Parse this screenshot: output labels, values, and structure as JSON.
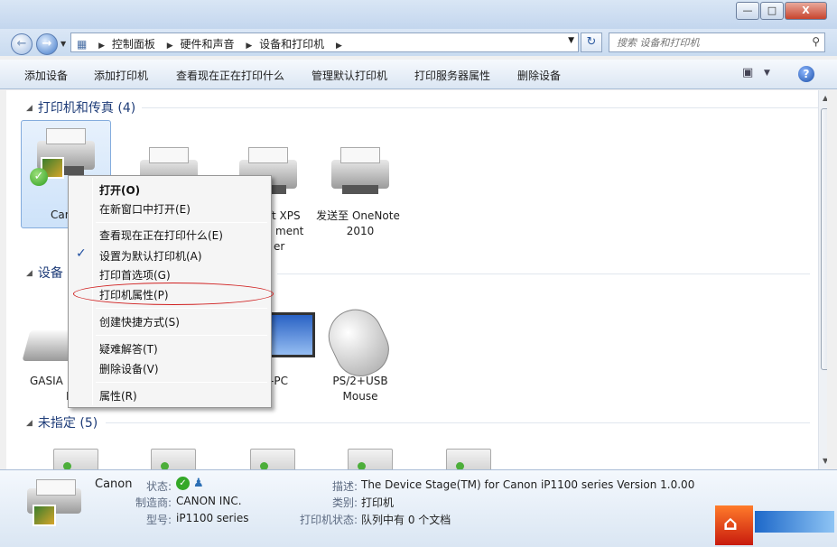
{
  "titlebar": {
    "minimize_icon": "minimize-icon",
    "maximize_icon": "maximize-icon",
    "close_icon": "close-icon"
  },
  "address": {
    "breadcrumbs": [
      "控制面板",
      "硬件和声音",
      "设备和打印机"
    ],
    "search_placeholder": "搜索 设备和打印机"
  },
  "toolbar": {
    "items": [
      "添加设备",
      "添加打印机",
      "查看现在正在打印什么",
      "管理默认打印机",
      "打印服务器属性",
      "删除设备"
    ]
  },
  "groups": {
    "printers": {
      "title": "打印机和传真 (4)"
    },
    "devices": {
      "title": "设备 (4"
    },
    "unspecified": {
      "title": "未指定 (5)"
    }
  },
  "printers": [
    {
      "label": "Can",
      "selected": true
    },
    {
      "label": ""
    },
    {
      "label": "ft XPS"
    },
    {
      "label1": "发送至 OneNote",
      "label2": "2010"
    }
  ],
  "printer_partial_lines": [
    "ment",
    "er"
  ],
  "devices": [
    {
      "label1": "GASIA",
      "label2": "Pr"
    },
    {
      "label": "-PC"
    },
    {
      "label1": "PS/2+USB",
      "label2": "Mouse"
    }
  ],
  "context_menu": {
    "items": [
      {
        "label": "打开(O)",
        "bold": true
      },
      {
        "label": "在新窗口中打开(E)"
      },
      {
        "label": "查看现在正在打印什么(E)"
      },
      {
        "label": "设置为默认打印机(A)",
        "checked": true
      },
      {
        "label": "打印首选项(G)"
      },
      {
        "label": "打印机属性(P)",
        "highlighted": true
      },
      {
        "label": "创建快捷方式(S)"
      },
      {
        "label": "疑难解答(T)"
      },
      {
        "label": "删除设备(V)"
      },
      {
        "label": "属性(R)"
      }
    ],
    "highlight_color": "#d02020"
  },
  "details": {
    "name": "Canon",
    "status_label": "状态:",
    "manufacturer_label": "制造商:",
    "manufacturer": "CANON INC.",
    "model_label": "型号:",
    "model": "iP1100 series",
    "description_label": "描述:",
    "description": "The Device Stage(TM) for Canon iP1100 series Version 1.0.00",
    "category_label": "类别:",
    "category": "打印机",
    "printer_status_label": "打印机状态:",
    "printer_status": "队列中有 0 个文档"
  }
}
